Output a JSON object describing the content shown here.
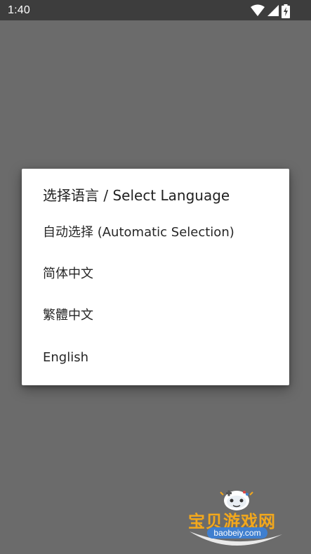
{
  "status_bar": {
    "time": "1:40",
    "icons": [
      "wifi-icon",
      "signal-icon",
      "battery-charging-icon"
    ]
  },
  "dialog": {
    "title": "选择语言 / Select Language",
    "options": [
      {
        "label": "自动选择 (Automatic Selection)"
      },
      {
        "label": "简体中文"
      },
      {
        "label": "繁體中文"
      },
      {
        "label": "English"
      }
    ]
  },
  "watermark": {
    "name": "宝贝游戏网",
    "url": "baobeiy.com"
  },
  "colors": {
    "scrim": "#6b6b6b",
    "status_bar": "#3d3d3d",
    "dialog_bg": "#ffffff",
    "text": "#212121",
    "watermark_orange": "#f3a81c",
    "watermark_blue": "#3f7fcf"
  }
}
